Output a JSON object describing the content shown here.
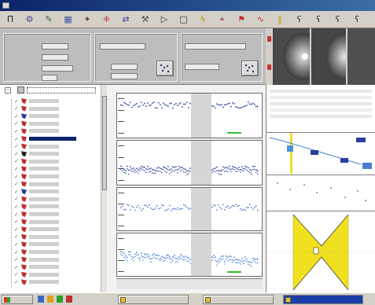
{
  "window": {
    "title": ""
  },
  "toolbar": {
    "buttons": [
      {
        "icon": "pi-icon",
        "glyph": "Π",
        "color": "#202020"
      },
      {
        "icon": "settings-icon",
        "glyph": "⚙",
        "color": "#4a4a8a"
      },
      {
        "icon": "tool-icon",
        "glyph": "✎",
        "color": "#2a6a2a"
      },
      {
        "icon": "chart-icon",
        "glyph": "▦",
        "color": "#3a5aa0"
      },
      {
        "icon": "wand-icon",
        "glyph": "✦",
        "color": "#6a4a2a"
      },
      {
        "icon": "grid-icon",
        "glyph": "⁜",
        "color": "#c03030"
      },
      {
        "icon": "arrows-icon",
        "glyph": "⇄",
        "color": "#3a3a8a"
      },
      {
        "icon": "tool2-icon",
        "glyph": "⚒",
        "color": "#505050"
      },
      {
        "icon": "play-icon",
        "glyph": "▷",
        "color": "#303030"
      },
      {
        "icon": "stop-icon",
        "glyph": "□",
        "color": "#303030"
      },
      {
        "icon": "lightning-icon",
        "glyph": "ϟ",
        "color": "#c09000"
      },
      {
        "icon": "target-icon",
        "glyph": "⌖",
        "color": "#a03030"
      },
      {
        "icon": "flag-icon",
        "glyph": "⚑",
        "color": "#c03030"
      },
      {
        "icon": "scan-icon",
        "glyph": "∿",
        "color": "#c03030"
      },
      {
        "icon": "bars-icon",
        "glyph": "‖",
        "color": "#c0a000"
      },
      {
        "icon": "glyph1-icon",
        "glyph": "ʕ",
        "color": "#303030"
      },
      {
        "icon": "glyph2-icon",
        "glyph": "ʕ",
        "color": "#303030"
      },
      {
        "icon": "glyph3-icon",
        "glyph": "ʕ",
        "color": "#303030"
      },
      {
        "icon": "glyph4-icon",
        "glyph": "ʕ",
        "color": "#303030"
      }
    ]
  },
  "colors": {
    "accent": "#0a246a",
    "series_dark": "#2a3fa0",
    "series_light": "#4a7fd0",
    "highlight_band": "#d6d6d6",
    "yellow": "#f0e020",
    "green": "#30c030"
  },
  "plots": {
    "title": "",
    "series_levels": [
      0.25,
      0.62,
      0.45,
      0.55
    ]
  },
  "tree": {
    "items": [
      {
        "icon": "node-icon",
        "color": "#c03030",
        "text": "",
        "selected": false
      },
      {
        "icon": "node-icon",
        "color": "#c03030",
        "text": "",
        "selected": false
      },
      {
        "icon": "node-icon",
        "color": "#2a3fa0",
        "text": "",
        "selected": false
      },
      {
        "icon": "node-icon",
        "color": "#c03030",
        "text": "",
        "selected": false
      },
      {
        "icon": "node-icon",
        "color": "#c03030",
        "text": "",
        "selected": false
      },
      {
        "icon": "node-icon",
        "color": "#c03030",
        "text": "",
        "selected": true
      },
      {
        "icon": "node-icon",
        "color": "#c03030",
        "text": "",
        "selected": false
      },
      {
        "icon": "node-icon",
        "color": "#202020",
        "text": "",
        "selected": false
      },
      {
        "icon": "node-icon",
        "color": "#c03030",
        "text": "",
        "selected": false
      },
      {
        "icon": "node-icon",
        "color": "#c03030",
        "text": "",
        "selected": false
      },
      {
        "icon": "node-icon",
        "color": "#c03030",
        "text": "",
        "selected": false
      },
      {
        "icon": "node-icon",
        "color": "#c03030",
        "text": "",
        "selected": false
      },
      {
        "icon": "node-icon",
        "color": "#2a3fa0",
        "text": "",
        "selected": false
      },
      {
        "icon": "node-icon",
        "color": "#c03030",
        "text": "",
        "selected": false
      },
      {
        "icon": "node-icon",
        "color": "#c03030",
        "text": "",
        "selected": false
      },
      {
        "icon": "node-icon",
        "color": "#c03030",
        "text": "",
        "selected": false
      },
      {
        "icon": "node-icon",
        "color": "#c03030",
        "text": "",
        "selected": false
      },
      {
        "icon": "node-icon",
        "color": "#c03030",
        "text": "",
        "selected": false
      },
      {
        "icon": "node-icon",
        "color": "#c03030",
        "text": "",
        "selected": false
      },
      {
        "icon": "node-icon",
        "color": "#c03030",
        "text": "",
        "selected": false
      },
      {
        "icon": "node-icon",
        "color": "#c03030",
        "text": "",
        "selected": false
      },
      {
        "icon": "node-icon",
        "color": "#c03030",
        "text": "",
        "selected": false
      },
      {
        "icon": "node-icon",
        "color": "#c03030",
        "text": "",
        "selected": false
      },
      {
        "icon": "node-icon",
        "color": "#c03030",
        "text": "",
        "selected": false
      },
      {
        "icon": "node-icon",
        "color": "#c03030",
        "text": "",
        "selected": false
      }
    ]
  },
  "taskbar": {
    "start_label": "",
    "tasks": [
      {
        "label": "",
        "active": false
      },
      {
        "label": "",
        "active": false
      },
      {
        "label": "",
        "active": true
      }
    ]
  }
}
